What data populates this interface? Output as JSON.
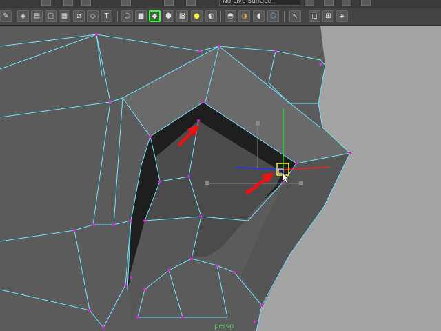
{
  "top_bar": {
    "field_value": "No Live Surface"
  },
  "toolbar": {
    "tools": [
      {
        "name": "paint-icon",
        "glyph": "✎"
      },
      {
        "name": "select-by-hierarchy-icon",
        "glyph": "◈"
      },
      {
        "name": "select-by-object-icon",
        "glyph": "▤"
      },
      {
        "name": "select-by-component-icon",
        "glyph": "▢"
      },
      {
        "name": "snap-to-grid-icon",
        "glyph": "▦"
      },
      {
        "name": "snap-to-curve-icon",
        "glyph": "⧄"
      },
      {
        "name": "snap-to-point-icon",
        "glyph": "◇"
      },
      {
        "name": "text-icon",
        "glyph": "T"
      },
      {
        "name": "wireframe-cube-icon",
        "glyph": "⬡"
      },
      {
        "name": "shaded-cube-icon",
        "glyph": "■"
      },
      {
        "name": "select-vertex-mode-icon",
        "glyph": "◆"
      },
      {
        "name": "face-mode-cube-icon",
        "glyph": "⬢"
      },
      {
        "name": "checker-texture-icon",
        "glyph": "▩"
      },
      {
        "name": "light-bulb-icon",
        "glyph": "●"
      },
      {
        "name": "shadow-sphere-icon",
        "glyph": "◐"
      },
      {
        "name": "render-sphere-icon",
        "glyph": "◓"
      },
      {
        "name": "half-sphere-icon",
        "glyph": "◑"
      },
      {
        "name": "isolate-select-icon",
        "glyph": "◖"
      },
      {
        "name": "xray-icon",
        "glyph": "⬠"
      },
      {
        "name": "camera-cursor-icon",
        "glyph": "↖"
      },
      {
        "name": "cube-outline-icon",
        "glyph": "◻"
      },
      {
        "name": "grid-square-icon",
        "glyph": "⊞"
      },
      {
        "name": "node-graph-icon",
        "glyph": "⚹"
      }
    ]
  },
  "viewport": {
    "camera_label": "persp",
    "background": "#a3a3a3",
    "mesh_fill": "#5b5b5b",
    "wire_color": "#6fe3ff",
    "vertex_color": "#d42cd4",
    "arrow_color": "#ee1111"
  }
}
